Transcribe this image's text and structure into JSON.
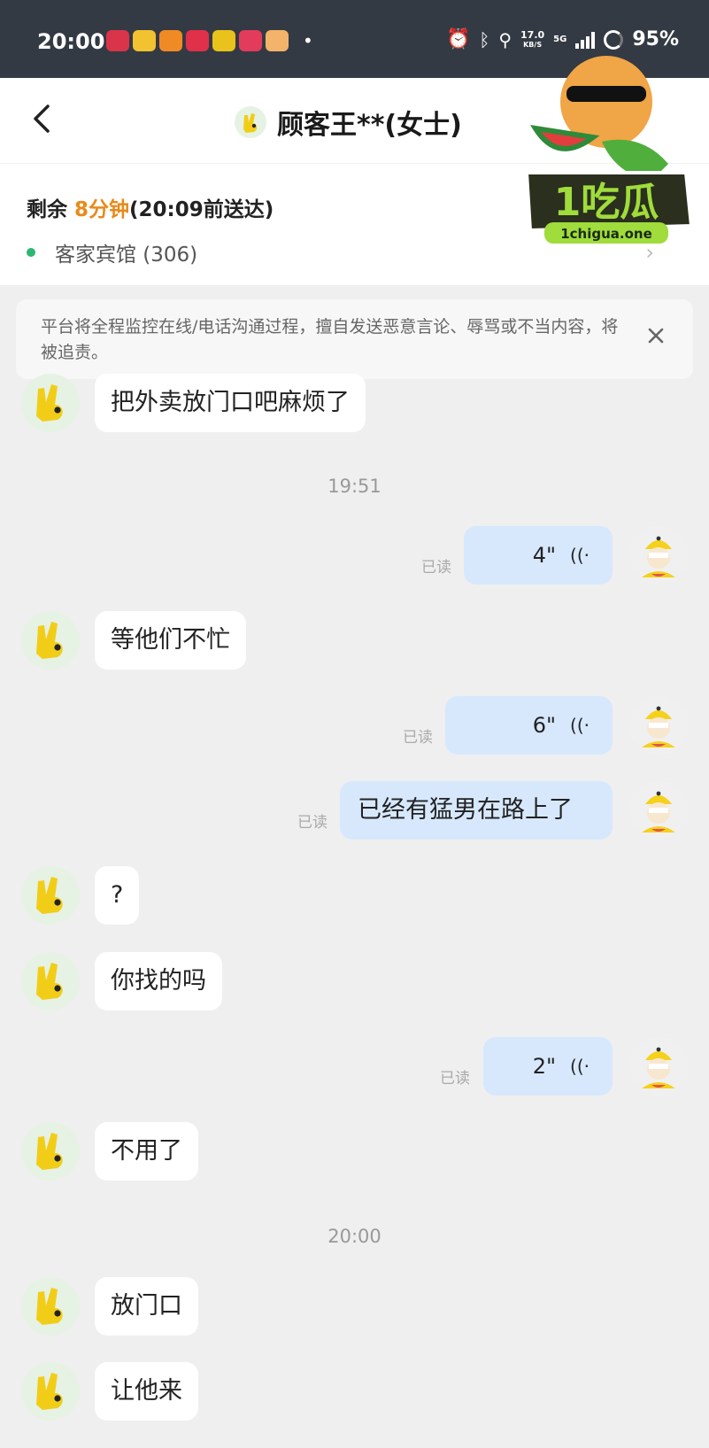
{
  "status_bar": {
    "time": "20:00",
    "speed_value": "17.0",
    "speed_unit": "KB/S",
    "network": "5G",
    "battery": "95%"
  },
  "header": {
    "title": "顾客王**(女士)"
  },
  "order": {
    "remain_prefix": "剩余 ",
    "remain_time": "8分钟",
    "remain_suffix": "(20:09前送达)",
    "address": "客家宾馆 (306)"
  },
  "notice": {
    "text": "平台将全程监控在线/电话沟通过程，擅自发送恶意言论、辱骂或不当内容，将被追责。"
  },
  "chat": {
    "m1": "把外卖放门口吧麻烦了",
    "ts1": "19:51",
    "v1": {
      "duration": "4\"",
      "status": "已读"
    },
    "m2": "等他们不忙",
    "v2": {
      "duration": "6\"",
      "status": "已读"
    },
    "m3": {
      "text": "已经有猛男在路上了",
      "status": "已读"
    },
    "m4": "?",
    "m5": "你找的吗",
    "v3": {
      "duration": "2\"",
      "status": "已读"
    },
    "m6": "不用了",
    "ts2": "20:00",
    "m7": "放门口",
    "m8": "让他来"
  },
  "watermark": {
    "brand": "1吃瓜",
    "site": "1chigua.one"
  },
  "colors": {
    "accent": "#e88a1a",
    "status_bar": "#343a44",
    "bubble_self": "#d7e8fd",
    "online_dot": "#2bb673"
  }
}
